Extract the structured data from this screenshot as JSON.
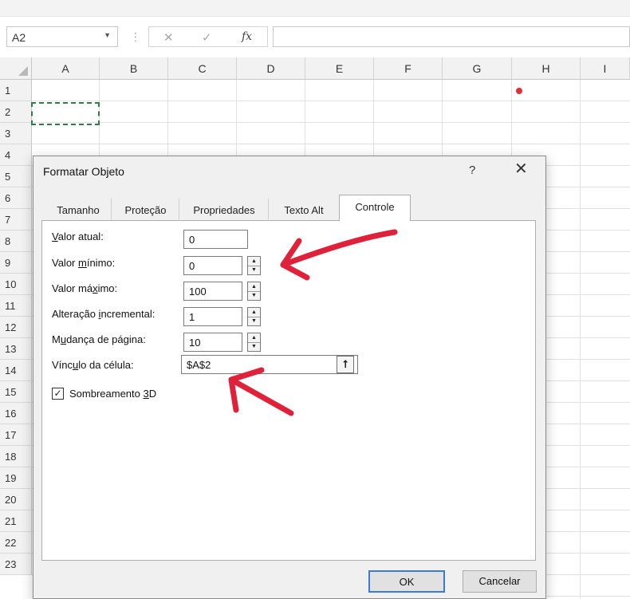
{
  "formula_bar": {
    "name_box": "A2",
    "fx_label": "fx",
    "cancel_icon": "✕",
    "enter_icon": "✓"
  },
  "columns": [
    "A",
    "B",
    "C",
    "D",
    "E",
    "F",
    "G",
    "H",
    "I"
  ],
  "rows": [
    "1",
    "2",
    "3",
    "4",
    "5",
    "6",
    "7",
    "8",
    "9",
    "10",
    "11",
    "12",
    "13",
    "14",
    "15",
    "16",
    "17",
    "18",
    "19",
    "20",
    "21",
    "22",
    "23"
  ],
  "dialog": {
    "title": "Formatar Objeto",
    "help": "?",
    "close": "✕",
    "tabs": [
      {
        "label": "Tamanho"
      },
      {
        "label": "Proteção"
      },
      {
        "label": "Propriedades"
      },
      {
        "label": "Texto Alt"
      },
      {
        "label": "Controle"
      }
    ],
    "active_tab": "Controle",
    "fields": {
      "valor_atual": {
        "label_ul": "V",
        "label_rest": "alor atual:",
        "value": "0"
      },
      "valor_minimo": {
        "label_pre": "Valor ",
        "label_ul": "m",
        "label_rest": "ínimo:",
        "value": "0"
      },
      "valor_maximo": {
        "label_pre": "Valor má",
        "label_ul": "x",
        "label_rest": "imo:",
        "value": "100"
      },
      "alteracao_incremental": {
        "label_pre": "Alteração ",
        "label_ul": "i",
        "label_rest": "ncremental:",
        "value": "1"
      },
      "mudanca_pagina": {
        "label_pre": "M",
        "label_ul": "u",
        "label_rest": "dança de página:",
        "value": "10"
      },
      "vinculo_celula": {
        "label_pre": "Vínc",
        "label_ul": "u",
        "label_rest": "lo da célula:",
        "value": "$A$2"
      }
    },
    "checkbox": {
      "label_pre": "Sombreamento ",
      "label_ul": "3",
      "label_rest": "D",
      "checked": true,
      "mark": "✓"
    },
    "buttons": {
      "ok": "OK",
      "cancel": "Cancelar"
    },
    "ref_icon": "⭡"
  },
  "annotation_color": "#e0213a"
}
